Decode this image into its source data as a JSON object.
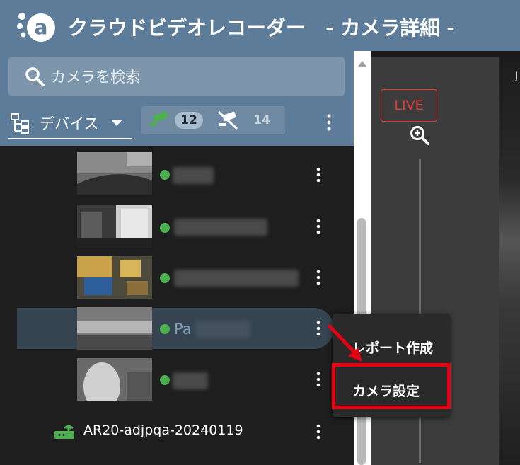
{
  "window": {
    "title": "クラウドビデオレコーダー　- カメラ詳細 -",
    "brand_color": "#5c7c99"
  },
  "search": {
    "placeholder": "カメラを検索",
    "icon": "search-icon"
  },
  "filter": {
    "device_label": "デバイス",
    "online_count": "12",
    "offline_count": "14"
  },
  "cameras": [
    {
      "status": "online"
    },
    {
      "status": "online"
    },
    {
      "status": "online"
    },
    {
      "status": "online",
      "name_prefix": "Pa",
      "selected": true
    },
    {
      "status": "online"
    }
  ],
  "router": {
    "label": "AR20-adjpqa-20240119"
  },
  "viewer": {
    "live_label": "LIVE",
    "edge_text": "J"
  },
  "context_menu": {
    "items": [
      "レポート作成",
      "カメラ設定"
    ]
  },
  "colors": {
    "online": "#4caf50",
    "live": "#e53935",
    "highlight": "#e60012"
  }
}
